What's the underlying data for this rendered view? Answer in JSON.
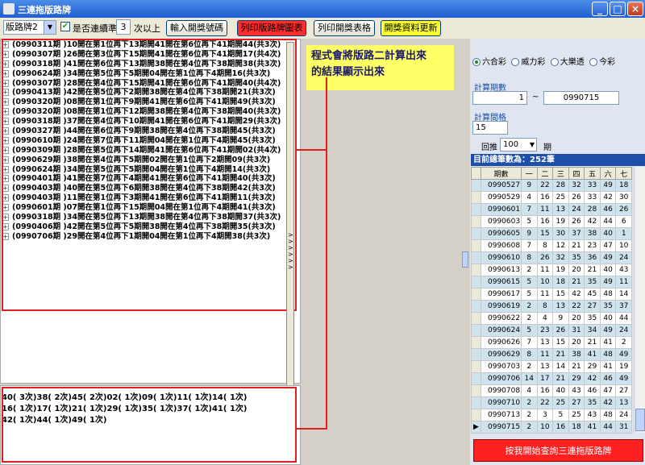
{
  "window": {
    "title": "三連拖版路牌"
  },
  "toolbar": {
    "combo_value": "版路牌2",
    "checkbox_label": "是否連續準",
    "count_value": "3",
    "count_suffix": "次以上",
    "btn_input": "輸入開獎號碼",
    "btn_print_chart": "列印版路牌圖表",
    "btn_print_table": "列印開獎表格",
    "btn_update": "開獎資料更新"
  },
  "tree_rows": [
    "(0990311期 )10開在第1位再下13期開41開在第6位再下41期開44(共3次)",
    "(0990307期 )26開在第3位再下15期開41開在第6位再下41期開17(共4次)",
    "(0990318期 )41開在第6位再下13期開38開在第4位再下38期開38(共3次)",
    "(0990624期 )34開在第5位再下5期開04開在第1位再下4期開16(共3次)",
    "(0990307期 )28開在第4位再下15期開41開在第6位再下41期開40(共4次)",
    "(0990413期 )42開在第5位再下2期開38開在第4位再下38期開21(共3次)",
    "(0990320期 )08開在第1位再下9期開41開在第6位再下41期開49(共3次)",
    "(0990320期 )08開在第1位再下12期開38開在第4位再下38期開40(共3次)",
    "(0990318期 )37開在第4位再下10期開41開在第6位再下41期開29(共3次)",
    "(0990327期 )44開在第6位再下9期開38開在第4位再下38期開45(共3次)",
    "(0990610期 )24開在第7位再下11期開04開在第1位再下4期開45(共3次)",
    "(0990309期 )28開在第5位再下14期開41開在第6位再下41期開02(共4次)",
    "(0990629期 )38開在第4位再下5期開02開在第1位再下2期開09(共3次)",
    "(0990624期 )34開在第5位再下5期開04開在第1位再下4期開14(共3次)",
    "(0990401期 )41開在第7位再下4期開41開在第6位再下41期開40(共3次)",
    "(0990403期 )40開在第5位再下6期開38開在第4位再下38期開42(共3次)",
    "(0990403期 )11開在第1位再下3期開41開在第6位再下41期開11(共3次)",
    "(0990601期 )07開在第1位再下15期開04開在第1位再下4期開41(共3次)",
    "(0990318期 )34開在第5位再下13期開38開在第4位再下38期開37(共3次)",
    "(0990406期 )42開在第5位再下5期開38開在第4位再下38期開35(共3次)",
    "(0990706期 )29開在第4位再下1期開04開在第1位再下4期開38(共3次)"
  ],
  "bottom_lines": [
    "40(  3次)38(  2次)45(  2次)02(  1次)09(  1次)11(  1次)14(  1次)",
    "16(  1次)17(  1次)21(  1次)29(  1次)35(  1次)37(  1次)41(  1次)",
    "42(  1次)44(  1次)49(  1次)"
  ],
  "note": {
    "line1": "程式會將版路二計算出來",
    "line2": "的結果顯示出來"
  },
  "lottery": {
    "options": [
      "六合彩",
      "威力彩",
      "大樂透",
      "今彩"
    ],
    "selected": "六合彩"
  },
  "calc_period": {
    "title": "計算期數",
    "from": "1",
    "sep": "~",
    "to": "0990715"
  },
  "calc_interval": {
    "title": "計算間格",
    "value": "15",
    "back_label": "回推",
    "back_value": "100",
    "unit": "期"
  },
  "total": {
    "label": "目前總筆數為：252筆"
  },
  "grid": {
    "headers": [
      "期數",
      "一",
      "二",
      "三",
      "四",
      "五",
      "六",
      "七"
    ],
    "rows": [
      [
        "0990527",
        "9",
        "22",
        "28",
        "32",
        "33",
        "49",
        "18"
      ],
      [
        "0990529",
        "4",
        "16",
        "25",
        "26",
        "33",
        "42",
        "30"
      ],
      [
        "0990601",
        "7",
        "11",
        "13",
        "24",
        "28",
        "46",
        "26"
      ],
      [
        "0990603",
        "5",
        "16",
        "19",
        "26",
        "42",
        "44",
        "6"
      ],
      [
        "0990605",
        "9",
        "15",
        "30",
        "37",
        "38",
        "40",
        "1"
      ],
      [
        "0990608",
        "7",
        "8",
        "12",
        "21",
        "23",
        "47",
        "10"
      ],
      [
        "0990610",
        "8",
        "26",
        "32",
        "35",
        "36",
        "49",
        "24"
      ],
      [
        "0990613",
        "2",
        "11",
        "19",
        "20",
        "21",
        "40",
        "43"
      ],
      [
        "0990615",
        "5",
        "10",
        "18",
        "21",
        "35",
        "49",
        "11"
      ],
      [
        "0990617",
        "5",
        "11",
        "15",
        "42",
        "45",
        "48",
        "14"
      ],
      [
        "0990619",
        "2",
        "8",
        "13",
        "22",
        "27",
        "35",
        "37"
      ],
      [
        "0990622",
        "2",
        "4",
        "9",
        "20",
        "35",
        "40",
        "44"
      ],
      [
        "0990624",
        "5",
        "23",
        "26",
        "31",
        "34",
        "49",
        "24"
      ],
      [
        "0990626",
        "7",
        "13",
        "15",
        "20",
        "21",
        "41",
        "2"
      ],
      [
        "0990629",
        "8",
        "11",
        "21",
        "38",
        "41",
        "48",
        "49"
      ],
      [
        "0990703",
        "2",
        "13",
        "14",
        "21",
        "29",
        "41",
        "19"
      ],
      [
        "0990706",
        "14",
        "17",
        "21",
        "29",
        "42",
        "46",
        "49"
      ],
      [
        "0990708",
        "4",
        "16",
        "40",
        "43",
        "46",
        "47",
        "27"
      ],
      [
        "0990710",
        "2",
        "22",
        "25",
        "27",
        "35",
        "42",
        "13"
      ],
      [
        "0990713",
        "2",
        "3",
        "5",
        "25",
        "43",
        "48",
        "24"
      ],
      [
        "0990715",
        "2",
        "10",
        "16",
        "18",
        "41",
        "44",
        "31"
      ]
    ]
  },
  "big_button": "按我開始查詢三連拖版路牌"
}
